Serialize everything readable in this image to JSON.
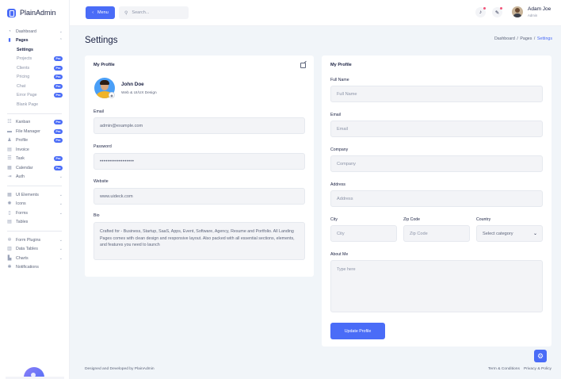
{
  "brand": {
    "name": "PlainAdmin"
  },
  "sidebar": {
    "items": [
      {
        "label": "Dashboard",
        "icon": "dashboard-icon",
        "chevron": "⌄"
      },
      {
        "label": "Pages",
        "icon": "pages-icon",
        "chevron": "⌃"
      }
    ],
    "pages_sub": [
      {
        "label": "Settings",
        "badge": ""
      },
      {
        "label": "Projects",
        "badge": "Pro"
      },
      {
        "label": "Clients",
        "badge": "Pro"
      },
      {
        "label": "Pricing",
        "badge": "Pro"
      },
      {
        "label": "Chat",
        "badge": "Pro"
      },
      {
        "label": "Error Page",
        "badge": "Pro"
      },
      {
        "label": "Blank Page",
        "badge": ""
      }
    ],
    "apps": [
      {
        "label": "Kanban",
        "icon": "kanban-icon",
        "badge": "Pro",
        "chevron": ""
      },
      {
        "label": "File Manager",
        "icon": "folder-icon",
        "badge": "Pro",
        "chevron": ""
      },
      {
        "label": "Profile",
        "icon": "user-icon",
        "badge": "Pro",
        "chevron": ""
      },
      {
        "label": "Invoice",
        "icon": "invoice-icon",
        "badge": "",
        "chevron": ""
      },
      {
        "label": "Task",
        "icon": "task-icon",
        "badge": "Pro",
        "chevron": ""
      },
      {
        "label": "Calendar",
        "icon": "calendar-icon",
        "badge": "Pro",
        "chevron": ""
      },
      {
        "label": "Auth",
        "icon": "auth-icon",
        "badge": "",
        "chevron": "⌄"
      }
    ],
    "ui": [
      {
        "label": "UI Elements",
        "icon": "grid-icon",
        "chevron": "⌄"
      },
      {
        "label": "Icons",
        "icon": "icons-icon",
        "chevron": "⌄"
      },
      {
        "label": "Forms",
        "icon": "forms-icon",
        "chevron": "⌄"
      },
      {
        "label": "Tables",
        "icon": "table-icon",
        "chevron": ""
      }
    ],
    "plugins": [
      {
        "label": "Form Plugins",
        "icon": "plugin-icon",
        "chevron": "⌄"
      },
      {
        "label": "Data Tables",
        "icon": "data-table-icon",
        "chevron": "⌄"
      },
      {
        "label": "Charts",
        "icon": "chart-icon",
        "chevron": "⌄"
      },
      {
        "label": "Notifications",
        "icon": "bell-icon",
        "chevron": ""
      }
    ]
  },
  "header": {
    "menu_label": "Menu",
    "search_placeholder": "Search...",
    "user_name": "Adam Joe",
    "user_role": "Admin"
  },
  "page": {
    "title": "Settings",
    "breadcrumb": [
      "Dashboard",
      "/",
      "Pages",
      "/",
      "Settings"
    ]
  },
  "my_profile_left": {
    "title": "My Profile",
    "name": "John Doe",
    "role": "Web & UI/UX Design",
    "email_label": "Email",
    "email_value": "admin@example.com",
    "password_label": "Password",
    "password_value": "••••••••••••••••••",
    "website_label": "Website",
    "website_value": "www.uideck.com",
    "bio_label": "Bio",
    "bio_value": "Crafted for - Business, Startup, SaaS, Apps, Event, Software, Agency, Resume and Portfolio. All Landing Pages comes with clean design and responsive layout. Also packed with all essential sections, elements, and features you need to launch"
  },
  "my_profile_right": {
    "title": "My Profile",
    "full_name_label": "Full Name",
    "full_name_placeholder": "Full Name",
    "email_label": "Email",
    "email_placeholder": "Email",
    "company_label": "Company",
    "company_placeholder": "Company",
    "address_label": "Address",
    "address_placeholder": "Address",
    "city_label": "City",
    "city_placeholder": "City",
    "zip_label": "Zip Code",
    "zip_placeholder": "Zip Code",
    "country_label": "Country",
    "country_selected": "Select category",
    "about_label": "About Me",
    "about_placeholder": "Type here",
    "update_button": "Update Profile"
  },
  "footer": {
    "left": "Designed and Developed by PlainAdmin",
    "terms": "Term & Conditions",
    "privacy": "Privacy & Policy"
  },
  "colors": {
    "accent": "#4a6cf7",
    "notification_dot": "#f2557a"
  }
}
